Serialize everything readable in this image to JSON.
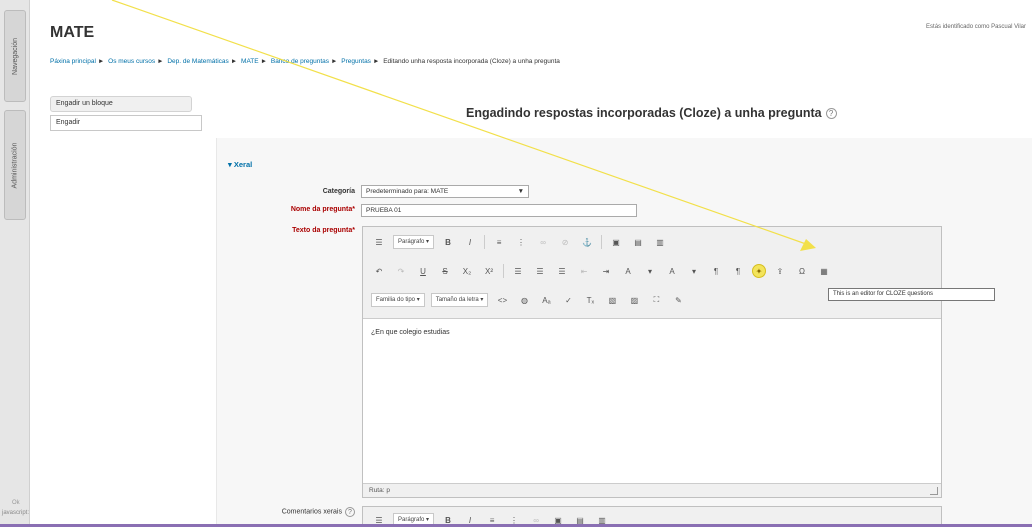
{
  "dock": {
    "tab_navigation": "Navegación",
    "tab_administration": "Administración",
    "footer_line1": "Ok",
    "footer_line2": "javascript:"
  },
  "header": {
    "course_title": "MATE",
    "login_info": "Estás identificado como Pascual Vilar",
    "login_user": "Pascual Vilar"
  },
  "breadcrumb": [
    "Páxina principal",
    "Os meus cursos",
    "Dep. de Matemáticas",
    "MATE",
    "Banco de preguntas",
    "Preguntas",
    "Editando unha resposta incorporada (Cloze) a unha pregunta"
  ],
  "breadcrumb_separator": "►",
  "block": {
    "header": "Engadir un bloque",
    "select_value": "Engadir"
  },
  "page": {
    "heading": "Engadindo respostas incorporadas (Cloze) a unha pregunta"
  },
  "form": {
    "section_legend": "Xeral",
    "category_label": "Categoría",
    "category_value": "Predeterminado para: MATE",
    "name_label": "Nome da pregunta",
    "name_value": "PRUEBA 01",
    "text_label": "Texto da pregunta",
    "required_mark": "*",
    "feedback_label": "Comentarios xerais"
  },
  "editor": {
    "paragraph_dropdown": "Parágrafo",
    "font_family_dropdown": "Familia do tipo",
    "font_size_dropdown": "Tamaño da letra",
    "content": "¿En que colegio estudias",
    "status_path": "Ruta: p",
    "cloze_tooltip": "This is an editor for CLOZE questions"
  },
  "annotation": {
    "arrow_color": "#f2e04a"
  }
}
